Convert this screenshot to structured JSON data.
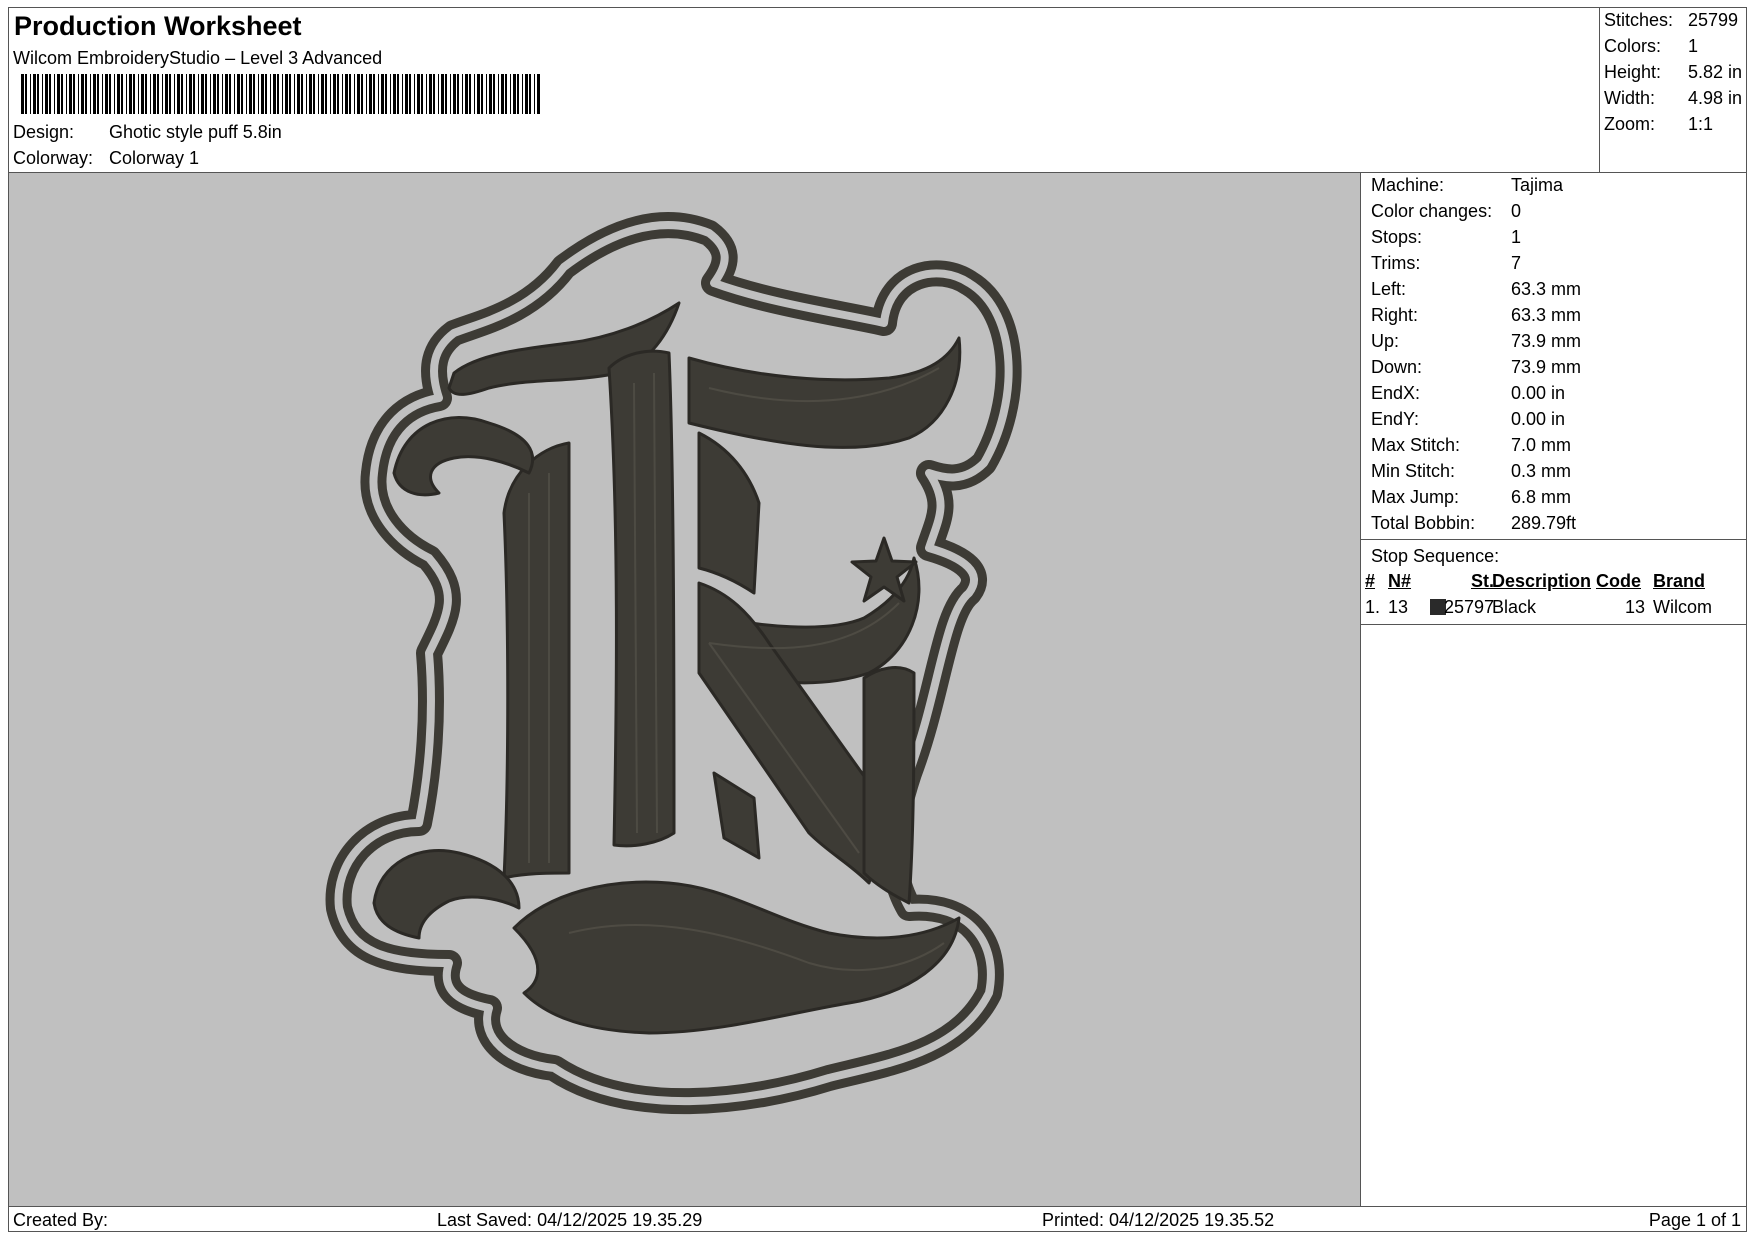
{
  "header": {
    "title": "Production Worksheet",
    "software": "Wilcom EmbroideryStudio – Level 3 Advanced",
    "design_label": "Design:",
    "design_value": "Ghotic style puff 5.8in",
    "colorway_label": "Colorway:",
    "colorway_value": "Colorway 1"
  },
  "stats": [
    {
      "label": "Stitches:",
      "value": "25799"
    },
    {
      "label": "Colors:",
      "value": "1"
    },
    {
      "label": "Height:",
      "value": "5.82 in"
    },
    {
      "label": "Width:",
      "value": "4.98 in"
    },
    {
      "label": "Zoom:",
      "value": "1:1"
    }
  ],
  "properties": [
    {
      "label": "Machine:",
      "value": "Tajima"
    },
    {
      "label": "Color changes:",
      "value": "0"
    },
    {
      "label": "Stops:",
      "value": "1"
    },
    {
      "label": "Trims:",
      "value": "7"
    },
    {
      "label": "Left:",
      "value": "63.3 mm"
    },
    {
      "label": "Right:",
      "value": "63.3 mm"
    },
    {
      "label": "Up:",
      "value": "73.9 mm"
    },
    {
      "label": "Down:",
      "value": "73.9 mm"
    },
    {
      "label": "EndX:",
      "value": "0.00 in"
    },
    {
      "label": "EndY:",
      "value": "0.00 in"
    },
    {
      "label": "Max Stitch:",
      "value": "7.0 mm"
    },
    {
      "label": "Min Stitch:",
      "value": "0.3 mm"
    },
    {
      "label": "Max Jump:",
      "value": "6.8 mm"
    },
    {
      "label": "Total Bobbin:",
      "value": "289.79ft"
    }
  ],
  "stop_sequence": {
    "label": "Stop Sequence:",
    "columns": {
      "idx": "#",
      "n": "N#",
      "st": "St.",
      "description": "Description",
      "code": "Code",
      "brand": "Brand"
    },
    "rows": [
      {
        "idx": "1.",
        "n": "13",
        "st": "25797",
        "description": "Black",
        "code": "13",
        "brand": "Wilcom",
        "color": "#2a2a2a"
      }
    ]
  },
  "colors": {
    "canvas_bg": "#c0c0c0",
    "thread": "#3d3b35"
  },
  "footer": {
    "created_by": "Created By:",
    "last_saved": "Last Saved: 04/12/2025 19.35.29",
    "printed": "Printed: 04/12/2025 19.35.52",
    "page": "Page 1 of 1"
  }
}
